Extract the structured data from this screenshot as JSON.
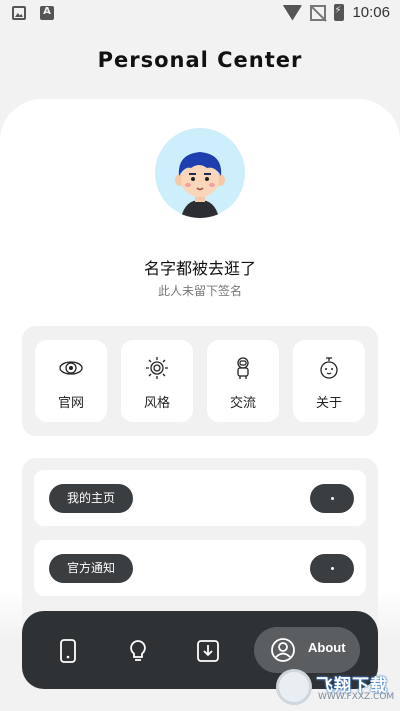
{
  "status_bar": {
    "time": "10:06",
    "icons": [
      "photo-icon",
      "a-icon",
      "wifi-icon",
      "no-signal-icon",
      "battery-charging-icon"
    ]
  },
  "header": {
    "title": "Personal Center"
  },
  "profile": {
    "name": "名字都被去逛了",
    "signature": "此人未留下签名",
    "avatar": "boy-avatar"
  },
  "quick_links": [
    {
      "label": "官网",
      "icon": "galaxy-icon"
    },
    {
      "label": "风格",
      "icon": "sun-spiral-icon"
    },
    {
      "label": "交流",
      "icon": "astronaut-icon"
    },
    {
      "label": "关于",
      "icon": "alarm-clock-icon"
    }
  ],
  "menu": [
    {
      "label": "我的主页"
    },
    {
      "label": "官方通知"
    }
  ],
  "tabbar": {
    "tabs": [
      {
        "icon": "phone-icon"
      },
      {
        "icon": "lightbulb-icon"
      },
      {
        "icon": "download-icon"
      },
      {
        "icon": "user-circle-icon",
        "label": "About",
        "active": true
      }
    ]
  },
  "watermark": {
    "text": "飞翔下载",
    "sub": "WWW.FXXZ.COM"
  },
  "colors": {
    "dark": "#3b3e40",
    "tabbar": "#2f3234",
    "avatar_bg": "#cdeefb"
  }
}
